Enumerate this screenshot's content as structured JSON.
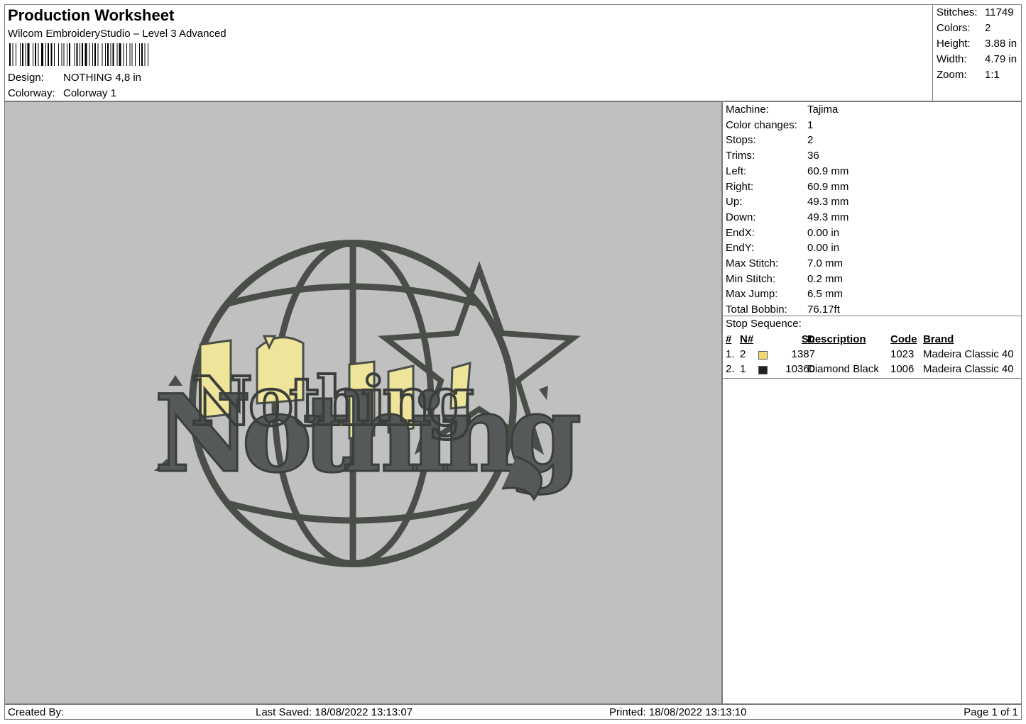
{
  "header": {
    "title": "Production Worksheet",
    "subtitle": "Wilcom EmbroideryStudio – Level 3 Advanced",
    "design_label": "Design:",
    "design_value": "NOTHING 4,8 in",
    "colorway_label": "Colorway:",
    "colorway_value": "Colorway 1"
  },
  "summary": [
    {
      "label": "Stitches:",
      "value": "11749"
    },
    {
      "label": "Colors:",
      "value": "2"
    },
    {
      "label": "Height:",
      "value": "3.88 in"
    },
    {
      "label": "Width:",
      "value": "4.79 in"
    },
    {
      "label": "Zoom:",
      "value": "1:1"
    }
  ],
  "machine_stats": [
    {
      "label": "Machine:",
      "value": "Tajima"
    },
    {
      "label": "Color changes:",
      "value": "1"
    },
    {
      "label": "Stops:",
      "value": "2"
    },
    {
      "label": "Trims:",
      "value": "36"
    },
    {
      "label": "Left:",
      "value": "60.9 mm"
    },
    {
      "label": "Right:",
      "value": "60.9 mm"
    },
    {
      "label": "Up:",
      "value": "49.3 mm"
    },
    {
      "label": "Down:",
      "value": "49.3 mm"
    },
    {
      "label": "EndX:",
      "value": "0.00 in"
    },
    {
      "label": "EndY:",
      "value": "0.00 in"
    },
    {
      "label": "Max Stitch:",
      "value": "7.0 mm"
    },
    {
      "label": "Min Stitch:",
      "value": "0.2 mm"
    },
    {
      "label": "Max Jump:",
      "value": "6.5 mm"
    },
    {
      "label": "Total Bobbin:",
      "value": "76.17ft"
    }
  ],
  "stop_sequence": {
    "title": "Stop Sequence:",
    "columns": {
      "num": "#",
      "n": "N#",
      "st": "St.",
      "description": "Description",
      "code": "Code",
      "brand": "Brand"
    },
    "rows": [
      {
        "num": "1.",
        "n": "2",
        "swatch": "#f0d870",
        "st": "1387",
        "description": "",
        "code": "1023",
        "brand": "Madeira Classic 40"
      },
      {
        "num": "2.",
        "n": "1",
        "swatch": "#222222",
        "st": "10360",
        "description": "Diamond Black",
        "code": "1006",
        "brand": "Madeira Classic 40"
      }
    ]
  },
  "design_preview": {
    "background": "#c0c0c0",
    "thread_dark": "#4a4e48",
    "thread_yellow": "#efe59a",
    "text": "Nothing"
  },
  "footer": {
    "created_by": "Created By:",
    "last_saved": "Last Saved: 18/08/2022 13:13:07",
    "printed": "Printed: 18/08/2022 13:13:10",
    "page": "Page 1 of 1"
  }
}
